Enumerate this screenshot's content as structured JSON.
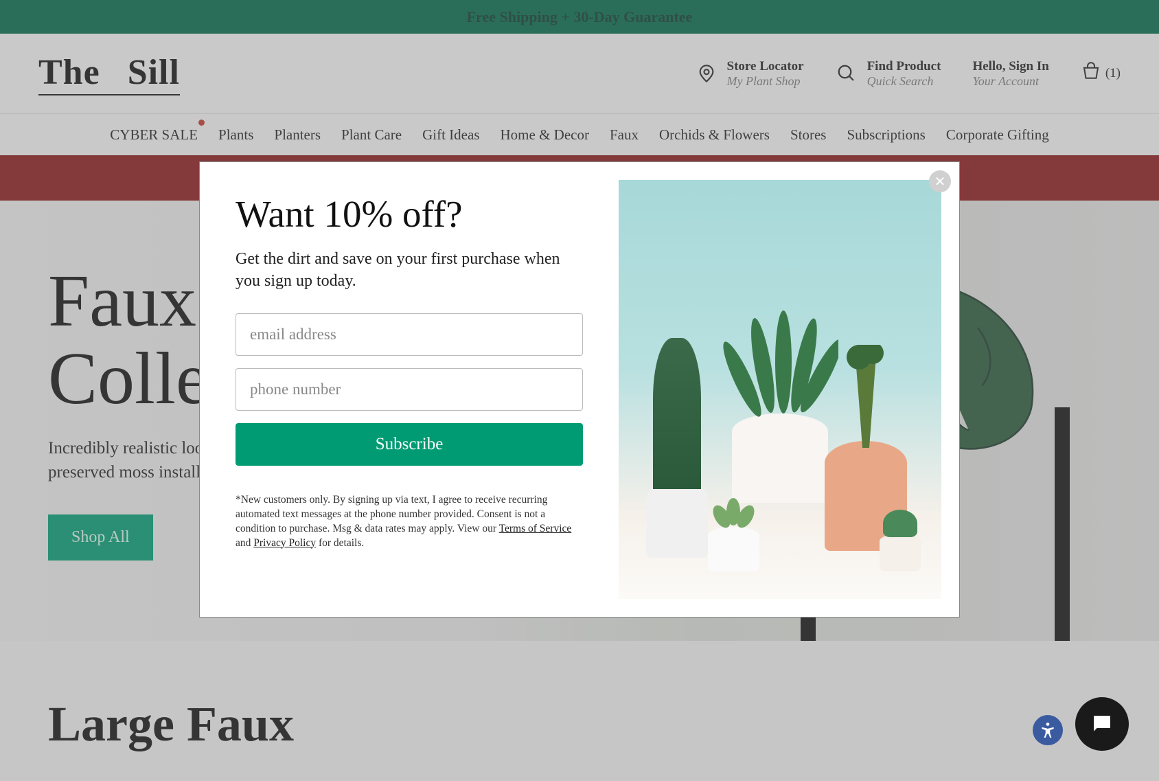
{
  "banner": {
    "text": "Free Shipping + 30-Day Guarantee"
  },
  "logo": {
    "part1": "The",
    "part2": "Sill"
  },
  "header": {
    "store": {
      "title": "Store Locator",
      "sub": "My Plant Shop"
    },
    "search": {
      "title": "Find Product",
      "sub": "Quick Search"
    },
    "account": {
      "title": "Hello, Sign In",
      "sub": "Your Account"
    },
    "cart_count": "(1)"
  },
  "nav": [
    "CYBER SALE",
    "Plants",
    "Planters",
    "Plant Care",
    "Gift Ideas",
    "Home & Decor",
    "Faux",
    "Orchids & Flowers",
    "Stores",
    "Subscriptions",
    "Corporate Gifting"
  ],
  "hero": {
    "title_line1": "Faux",
    "title_line2": "Collection",
    "sub": "Incredibly realistic looking faux plants and trees, plus preserved moss installations for a",
    "button": "Shop All"
  },
  "section": {
    "title": "Large Faux"
  },
  "modal": {
    "title": "Want 10% off?",
    "sub": "Get the dirt and save on your first purchase when you sign up today.",
    "email_placeholder": "email address",
    "phone_placeholder": "phone number",
    "subscribe": "Subscribe",
    "disclaimer_1": "*New customers only. By signing up via text, I agree to receive recurring automated text messages at the phone number provided. Consent is not a condition to purchase. Msg & data rates may apply. View our ",
    "tos": "Terms of Service",
    "and": " and ",
    "privacy": "Privacy Policy",
    "disclaimer_2": " for details."
  }
}
